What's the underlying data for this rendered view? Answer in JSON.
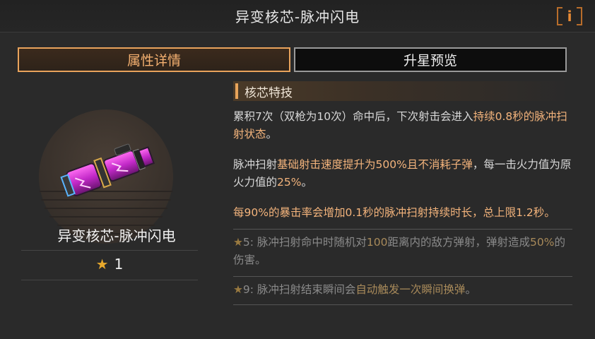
{
  "header": {
    "title": "异变核芯-脉冲闪电",
    "info_label": "i"
  },
  "tabs": [
    {
      "label": "属性详情",
      "active": true
    },
    {
      "label": "升星预览",
      "active": false
    }
  ],
  "item": {
    "name": "异变核芯-脉冲闪电",
    "star_count": "1",
    "star_icon": "star-icon"
  },
  "section": {
    "title": "核芯特技",
    "p1_a": "累积7次（双枪为10次）命中后，下次射击会进入",
    "p1_b": "持续0.8秒的脉冲扫射状态",
    "p1_c": "。",
    "p2_a": "脉冲扫射",
    "p2_b": "基础射击速度提升为500%且不消耗子弹",
    "p2_c": "，每一击火力值为原火力值的",
    "p2_d": "25%",
    "p2_e": "。",
    "p3": "每90%的暴击率会增加0.1秒的脉冲扫射持续时长，总上限1.2秒。",
    "star5_a": "5: 脉冲扫射命中时随机对",
    "star5_b": "100",
    "star5_c": "距离内的敌方弹射，弹射造成",
    "star5_d": "50%",
    "star5_e": "的伤害。",
    "star9_a": "9: 脉冲扫射结束瞬间会",
    "star9_b": "自动触发一次瞬间换弹",
    "star9_c": "。"
  },
  "colors": {
    "accent": "#e9a35c",
    "highlight": "#f4b47c",
    "star": "#e8a92c"
  }
}
